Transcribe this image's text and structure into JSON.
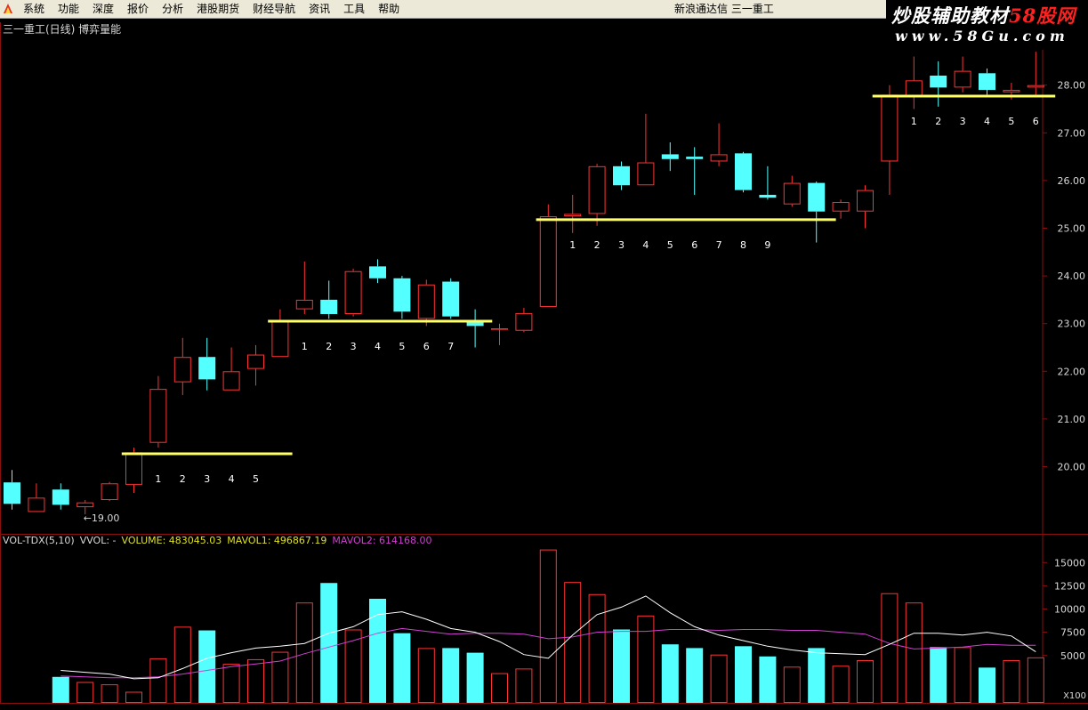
{
  "menubar": {
    "items": [
      "系统",
      "功能",
      "深度",
      "报价",
      "分析",
      "港股期货",
      "财经导航",
      "资讯",
      "工具",
      "帮助"
    ],
    "app_title": "新浪通达信  三一重工"
  },
  "watermark": {
    "line1_left": "炒股辅助教材",
    "line1_right": "58股网",
    "line2": "www.58Gu.com"
  },
  "stock_title": "三一重工(日线) 博弈量能",
  "vol_header": {
    "name": "VOL-TDX(5,10)",
    "vvol": "VVOL: -",
    "volume": "VOLUME: 483045.03",
    "mavol1": "MAVOL1: 496867.19",
    "mavol2": "MAVOL2: 614168.00"
  },
  "colors": {
    "up": "#ff3232",
    "down": "#54ffff",
    "support": "#ffff66",
    "ma1": "#ffffff",
    "ma2": "#d040d0",
    "grid": "#8a1010",
    "axis_text": "#d8d8d8"
  },
  "chart_data": [
    {
      "type": "candlestick",
      "y_ticks": [
        "20.00",
        "21.00",
        "22.00",
        "23.00",
        "24.00",
        "25.00",
        "26.00",
        "27.00",
        "28.00"
      ],
      "low_annotation": "←19.00",
      "candles": [
        {
          "o": 19.67,
          "h": 19.93,
          "l": 19.1,
          "c": 19.22
        },
        {
          "o": 19.05,
          "h": 19.65,
          "l": 19.05,
          "c": 19.35
        },
        {
          "o": 19.52,
          "h": 19.65,
          "l": 19.1,
          "c": 19.2
        },
        {
          "o": 19.15,
          "h": 19.3,
          "l": 19.0,
          "c": 19.25
        },
        {
          "o": 19.3,
          "h": 19.68,
          "l": 19.28,
          "c": 19.65
        },
        {
          "o": 19.62,
          "h": 20.4,
          "l": 19.45,
          "c": 20.3
        },
        {
          "o": 20.5,
          "h": 21.9,
          "l": 20.4,
          "c": 21.63
        },
        {
          "o": 21.77,
          "h": 22.7,
          "l": 21.5,
          "c": 22.3
        },
        {
          "o": 22.3,
          "h": 22.7,
          "l": 21.6,
          "c": 21.83
        },
        {
          "o": 21.6,
          "h": 22.5,
          "l": 21.6,
          "c": 22.0
        },
        {
          "o": 22.05,
          "h": 22.55,
          "l": 21.7,
          "c": 22.35
        },
        {
          "o": 22.3,
          "h": 23.3,
          "l": 22.3,
          "c": 23.05
        },
        {
          "o": 23.3,
          "h": 24.3,
          "l": 23.2,
          "c": 23.5
        },
        {
          "o": 23.5,
          "h": 23.9,
          "l": 23.1,
          "c": 23.2
        },
        {
          "o": 23.2,
          "h": 24.15,
          "l": 23.15,
          "c": 24.1
        },
        {
          "o": 24.2,
          "h": 24.35,
          "l": 23.85,
          "c": 23.95
        },
        {
          "o": 23.95,
          "h": 24.0,
          "l": 23.1,
          "c": 23.25
        },
        {
          "o": 23.1,
          "h": 23.92,
          "l": 22.95,
          "c": 23.82
        },
        {
          "o": 23.88,
          "h": 23.95,
          "l": 23.1,
          "c": 23.15
        },
        {
          "o": 23.05,
          "h": 23.3,
          "l": 22.5,
          "c": 22.95
        },
        {
          "o": 22.87,
          "h": 23.0,
          "l": 22.55,
          "c": 22.9
        },
        {
          "o": 22.85,
          "h": 23.33,
          "l": 22.82,
          "c": 23.22
        },
        {
          "o": 23.35,
          "h": 25.5,
          "l": 23.35,
          "c": 25.25
        },
        {
          "o": 25.25,
          "h": 25.7,
          "l": 24.9,
          "c": 25.3
        },
        {
          "o": 25.3,
          "h": 26.35,
          "l": 25.05,
          "c": 26.3
        },
        {
          "o": 26.3,
          "h": 26.4,
          "l": 25.8,
          "c": 25.9
        },
        {
          "o": 25.9,
          "h": 27.4,
          "l": 25.9,
          "c": 26.38
        },
        {
          "o": 26.55,
          "h": 26.8,
          "l": 26.2,
          "c": 26.45
        },
        {
          "o": 26.5,
          "h": 26.7,
          "l": 25.7,
          "c": 26.45
        },
        {
          "o": 26.4,
          "h": 27.2,
          "l": 26.3,
          "c": 26.55
        },
        {
          "o": 26.57,
          "h": 26.6,
          "l": 25.75,
          "c": 25.8
        },
        {
          "o": 25.7,
          "h": 26.3,
          "l": 25.6,
          "c": 25.64
        },
        {
          "o": 25.5,
          "h": 26.1,
          "l": 25.45,
          "c": 25.95
        },
        {
          "o": 25.95,
          "h": 25.98,
          "l": 24.7,
          "c": 25.35
        },
        {
          "o": 25.35,
          "h": 25.6,
          "l": 25.2,
          "c": 25.55
        },
        {
          "o": 25.35,
          "h": 25.9,
          "l": 25.0,
          "c": 25.8
        },
        {
          "o": 26.4,
          "h": 28.0,
          "l": 25.7,
          "c": 27.8
        },
        {
          "o": 27.75,
          "h": 28.6,
          "l": 27.5,
          "c": 28.1
        },
        {
          "o": 28.2,
          "h": 28.5,
          "l": 27.55,
          "c": 27.95
        },
        {
          "o": 27.95,
          "h": 28.6,
          "l": 27.85,
          "c": 28.3
        },
        {
          "o": 28.25,
          "h": 28.35,
          "l": 27.8,
          "c": 27.9
        },
        {
          "o": 27.85,
          "h": 28.05,
          "l": 27.7,
          "c": 27.9
        },
        {
          "o": 27.95,
          "h": 28.7,
          "l": 27.8,
          "c": 28.0
        }
      ],
      "support_lines": [
        {
          "price": 20.27,
          "from": 4.5,
          "to": 11.5,
          "labels": [
            "1",
            "2",
            "3",
            "4",
            "5"
          ],
          "label_start": 6
        },
        {
          "price": 23.05,
          "from": 10.5,
          "to": 19.7,
          "labels": [
            "1",
            "2",
            "3",
            "4",
            "5",
            "6",
            "7"
          ],
          "label_start": 12
        },
        {
          "price": 25.18,
          "from": 21.5,
          "to": 33.8,
          "labels": [
            "1",
            "2",
            "3",
            "4",
            "5",
            "6",
            "7",
            "8",
            "9"
          ],
          "label_start": 23
        },
        {
          "price": 27.77,
          "from": 35.3,
          "to": 42.8,
          "labels": [
            "1",
            "2",
            "3",
            "4",
            "5",
            "6"
          ],
          "label_start": 37
        }
      ]
    },
    {
      "type": "bar",
      "title": "VOL-TDX(5,10)",
      "y_ticks": [
        "5000",
        "7500",
        "10000",
        "12500",
        "15000"
      ],
      "y_unit": "X100",
      "volumes": [
        2700,
        2150,
        1900,
        1100,
        4700,
        8100,
        7700,
        4100,
        4600,
        5400,
        10700,
        12800,
        7800,
        11100,
        7400,
        5800,
        5800,
        5300,
        3100,
        3600,
        16400,
        12900,
        11600,
        7800,
        9300,
        6200,
        5800,
        5100,
        6000,
        4900,
        3800,
        5800,
        3900,
        4500,
        11700,
        10700,
        5900,
        5900,
        3700,
        4500,
        4800
      ],
      "mavol1": [
        3400,
        3200,
        3000,
        2500,
        2600,
        3600,
        4700,
        5300,
        5800,
        6000,
        6300,
        7400,
        8100,
        9400,
        9700,
        8900,
        7900,
        7500,
        6500,
        5100,
        4700,
        7200,
        9400,
        10200,
        11400,
        9600,
        8100,
        7200,
        6600,
        6000,
        5600,
        5300,
        5200,
        5100,
        6200,
        7400,
        7400,
        7200,
        7500,
        7100,
        5400
      ],
      "mavol2": [
        2800,
        2700,
        2600,
        2600,
        2700,
        3000,
        3400,
        3800,
        4100,
        4400,
        5200,
        5900,
        6600,
        7400,
        7900,
        7600,
        7300,
        7400,
        7400,
        7300,
        6800,
        7000,
        7500,
        7600,
        7600,
        7800,
        7800,
        7700,
        7800,
        7800,
        7700,
        7700,
        7500,
        7300,
        6300,
        5700,
        5800,
        5900,
        6200,
        6100,
        6100
      ]
    }
  ]
}
